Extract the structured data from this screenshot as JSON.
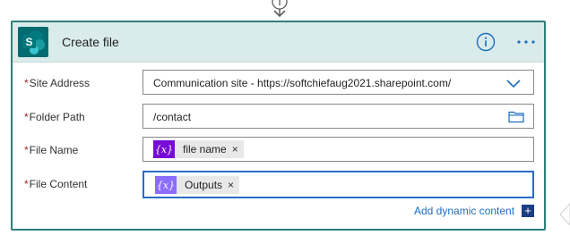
{
  "action": {
    "title": "Create file",
    "connector": "SharePoint",
    "icons": {
      "logo": "sharepoint-logo-icon",
      "info": "info-icon",
      "more": "more-options-icon"
    }
  },
  "fields": {
    "site_address": {
      "required_mark": "*",
      "label": "Site Address",
      "value": "Communication site - https://softchiefaug2021.sharepoint.com/"
    },
    "folder_path": {
      "required_mark": "*",
      "label": "Folder Path",
      "value": "/contact"
    },
    "file_name": {
      "required_mark": "*",
      "label": "File Name",
      "token": {
        "icon_text": "{x}",
        "label": "file name",
        "remove": "×",
        "color": "#770bd6"
      }
    },
    "file_content": {
      "required_mark": "*",
      "label": "File Content",
      "token": {
        "icon_text": "{x}",
        "label": "Outputs",
        "remove": "×",
        "color": "#8c6cff"
      }
    }
  },
  "dynamic_content": {
    "link_label": "Add dynamic content",
    "plus": "+"
  },
  "colors": {
    "card_border": "#2f7f7a",
    "header_bg": "#d9ebea",
    "link": "#1b6ec2",
    "focus_border": "#2b6cc4",
    "required": "#a4262c"
  }
}
